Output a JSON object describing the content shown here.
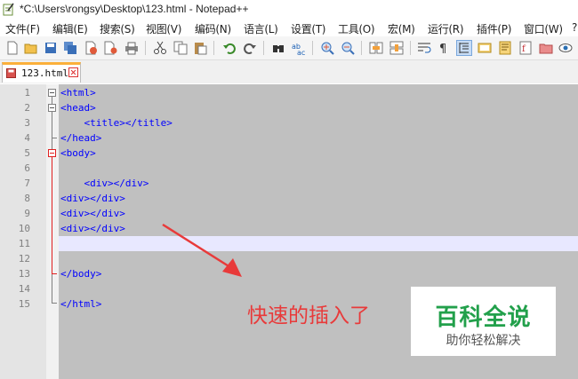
{
  "window": {
    "title": "*C:\\Users\\rongsy\\Desktop\\123.html - Notepad++"
  },
  "menu": [
    {
      "label": "文件(F)"
    },
    {
      "label": "编辑(E)"
    },
    {
      "label": "搜索(S)"
    },
    {
      "label": "视图(V)"
    },
    {
      "label": "编码(N)"
    },
    {
      "label": "语言(L)"
    },
    {
      "label": "设置(T)"
    },
    {
      "label": "工具(O)"
    },
    {
      "label": "宏(M)"
    },
    {
      "label": "运行(R)"
    },
    {
      "label": "插件(P)"
    },
    {
      "label": "窗口(W)"
    },
    {
      "label": "?"
    }
  ],
  "toolbar": {
    "icons": [
      "new-file-icon",
      "open-file-icon",
      "save-icon",
      "save-all-icon",
      "close-icon",
      "close-all-icon",
      "print-icon",
      "cut-icon",
      "copy-icon",
      "paste-icon",
      "undo-icon",
      "redo-icon",
      "find-icon",
      "replace-icon",
      "zoom-in-icon",
      "zoom-out-icon",
      "sync-vertical-icon",
      "sync-horizontal-icon",
      "word-wrap-icon",
      "show-all-chars-icon",
      "indent-guide-icon",
      "user-lang-icon",
      "doc-map-icon",
      "function-list-icon",
      "folder-workspace-icon",
      "monitoring-icon"
    ]
  },
  "tab": {
    "label": "123.html"
  },
  "editor": {
    "current_line": 11,
    "lines": [
      {
        "num": "1",
        "code": "<html>"
      },
      {
        "num": "2",
        "code": "<head>"
      },
      {
        "num": "3",
        "code": "    <title></title>"
      },
      {
        "num": "4",
        "code": "</head>"
      },
      {
        "num": "5",
        "code": "<body>"
      },
      {
        "num": "6",
        "code": ""
      },
      {
        "num": "7",
        "code": "    <div></div>"
      },
      {
        "num": "8",
        "code": "<div></div>"
      },
      {
        "num": "9",
        "code": "<div></div>"
      },
      {
        "num": "10",
        "code": "<div></div>"
      },
      {
        "num": "11",
        "code": ""
      },
      {
        "num": "12",
        "code": ""
      },
      {
        "num": "13",
        "code": "</body>"
      },
      {
        "num": "14",
        "code": ""
      },
      {
        "num": "15",
        "code": "</html>"
      }
    ]
  },
  "annotation": {
    "text": "快速的插入了",
    "color": "#e83a3a"
  },
  "watermark": {
    "title": "百科全说",
    "subtitle": "助你轻松解决"
  }
}
